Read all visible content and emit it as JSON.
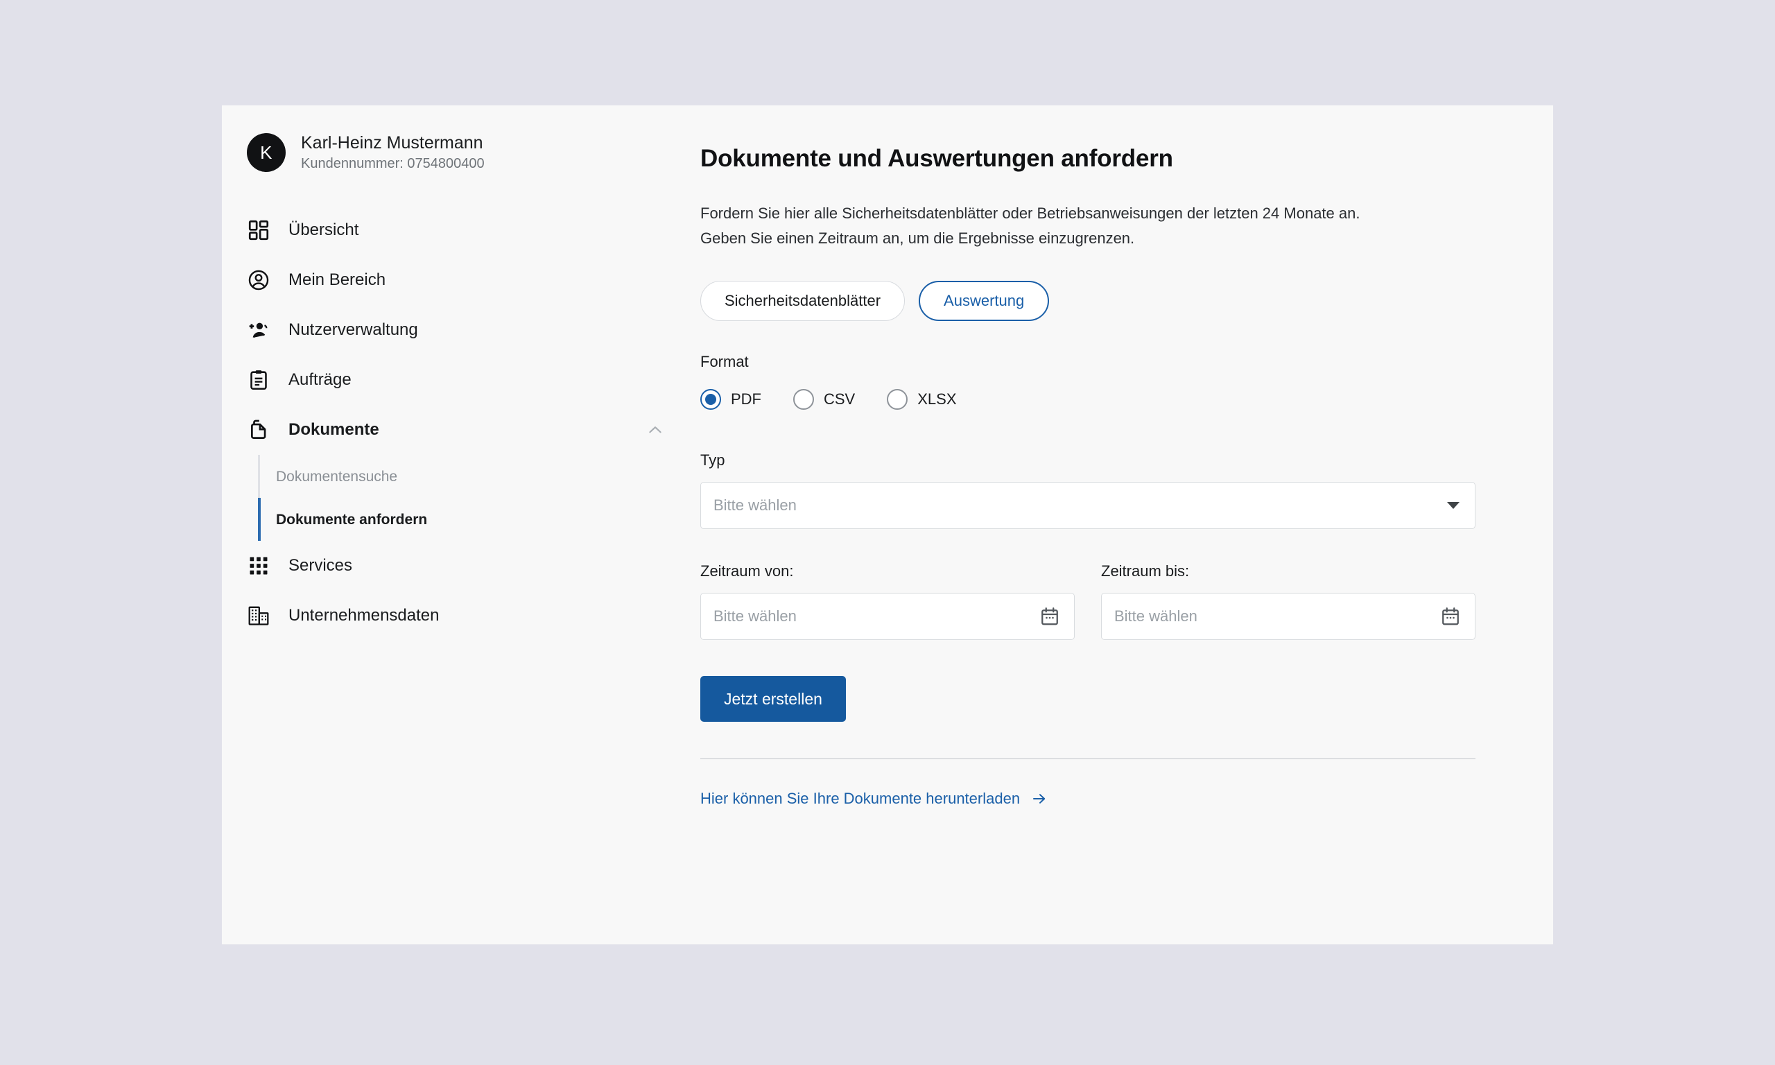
{
  "profile": {
    "avatar_initial": "K",
    "name": "Karl-Heinz Mustermann",
    "customer_line": "Kundennummer: 0754800400"
  },
  "sidebar": {
    "items": [
      {
        "label": "Übersicht",
        "icon": "dashboard-grid-icon"
      },
      {
        "label": "Mein Bereich",
        "icon": "account-circle-icon"
      },
      {
        "label": "Nutzerverwaltung",
        "icon": "person-add-icon"
      },
      {
        "label": "Aufträge",
        "icon": "clipboard-icon"
      },
      {
        "label": "Dokumente",
        "icon": "documents-copy-icon"
      },
      {
        "label": "Services",
        "icon": "apps-grid-icon"
      },
      {
        "label": "Unternehmensdaten",
        "icon": "building-icon"
      }
    ],
    "subnav": [
      {
        "label": "Dokumentensuche"
      },
      {
        "label": "Dokumente anfordern"
      }
    ]
  },
  "main": {
    "title": "Dokumente und Auswertungen anfordern",
    "intro_line1": "Fordern Sie hier alle Sicherheitsdatenblätter oder Betriebsanweisungen der letzten 24 Monate an.",
    "intro_line2": "Geben Sie einen Zeitraum an, um die Ergebnisse einzugrenzen.",
    "segments": [
      {
        "label": "Sicherheitsdatenblätter"
      },
      {
        "label": "Auswertung"
      }
    ],
    "format": {
      "label": "Format",
      "options": [
        {
          "label": "PDF"
        },
        {
          "label": "CSV"
        },
        {
          "label": "XLSX"
        }
      ]
    },
    "typ": {
      "label": "Typ",
      "value": "Bitte wählen"
    },
    "date_from": {
      "label": "Zeitraum von:",
      "value": "Bitte wählen"
    },
    "date_to": {
      "label": "Zeitraum bis:",
      "value": "Bitte wählen"
    },
    "submit_label": "Jetzt erstellen",
    "download_link": "Hier können Sie Ihre Dokumente herunterladen"
  },
  "colors": {
    "accent_blue": "#1a5fa8",
    "button_blue": "#15599e",
    "page_background": "#e1e1ea",
    "card_background": "#f8f8f8",
    "muted_text": "#9aa0a6"
  }
}
